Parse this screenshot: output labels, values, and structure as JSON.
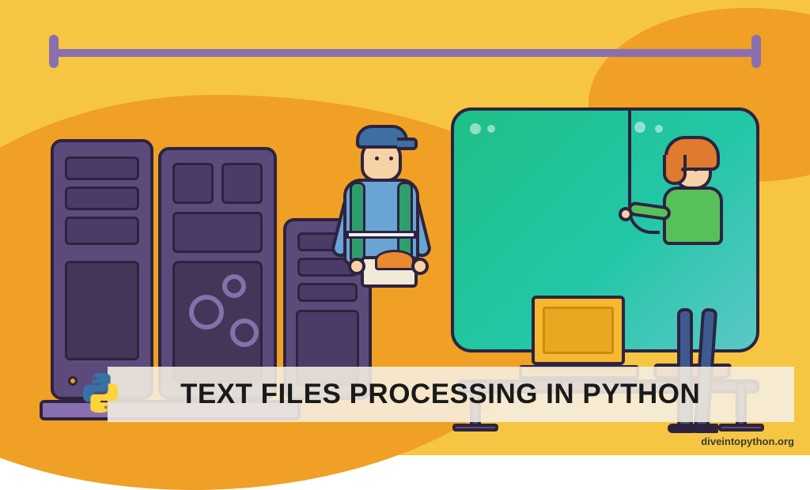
{
  "title": "TEXT FILES PROCESSING IN PYTHON",
  "credit": "diveintopython.org",
  "logo_name": "python-logo"
}
